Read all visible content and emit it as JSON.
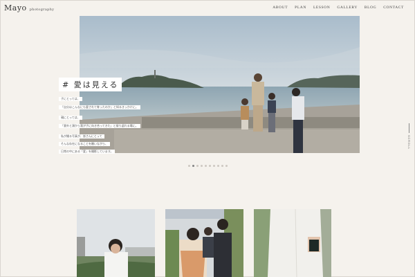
{
  "header": {
    "logo_name": "Mayo",
    "logo_sub": "photography",
    "nav": [
      "ABOUT",
      "PLAN",
      "LESSON",
      "GALLERY",
      "BLOG",
      "CONTACT"
    ]
  },
  "hero": {
    "headline": "# 愛は見える",
    "captions": [
      "子にとっては、",
      "「自分はこんなにも愛されて育ったのか」と知るきっかけに。",
      "親にとっては、",
      "「意外と頭から我が子に向き合ってきた」と振り返れる場に。",
      "私が撮る写真が、皆さんにとって",
      "そんな存在になることを願いながら、",
      "日常の中にある「愛」を撮影しています。"
    ]
  },
  "slider": {
    "count": 10,
    "active_index": 1
  },
  "scroll_label": "SCROLL",
  "colors": {
    "background": "#f5f2ed",
    "text": "#333333"
  }
}
